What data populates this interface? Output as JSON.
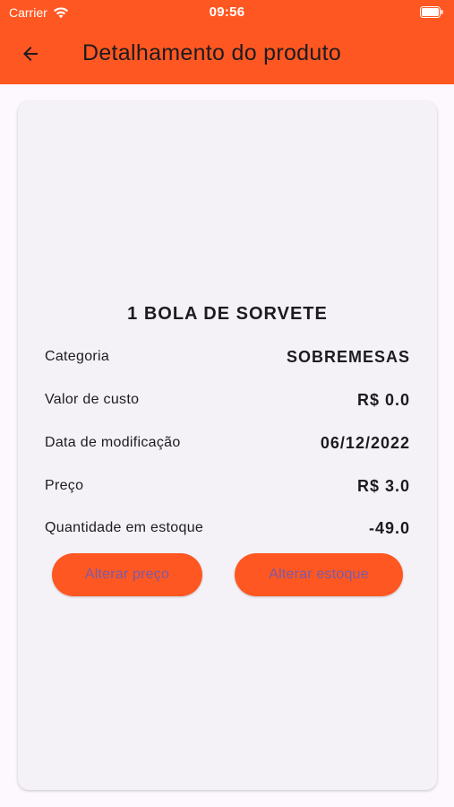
{
  "status_bar": {
    "carrier": "Carrier",
    "time": "09:56"
  },
  "app_bar": {
    "title": "Detalhamento do produto",
    "back_icon": "arrow-back-icon",
    "color": "#ff5722"
  },
  "product": {
    "name": "1 BOLA DE SORVETE",
    "details": [
      {
        "label": "Categoria",
        "value": "SOBREMESAS"
      },
      {
        "label": "Valor de custo",
        "value": "R$ 0.0"
      },
      {
        "label": "Data de modificação",
        "value": "06/12/2022"
      },
      {
        "label": "Preço",
        "value": "R$ 3.0"
      },
      {
        "label": "Quantidade em estoque",
        "value": "-49.0"
      }
    ]
  },
  "actions": {
    "change_price_label": "Alterar preço",
    "change_stock_label": "Alterar estoque",
    "button_color": "#ff5722",
    "button_text_color": "#7a5aa6"
  }
}
